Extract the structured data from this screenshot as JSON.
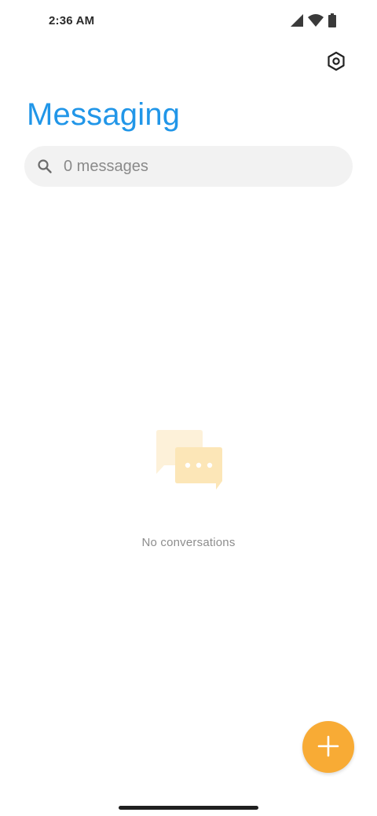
{
  "status_bar": {
    "time": "2:36 AM",
    "icons": [
      "signal-icon",
      "wifi-icon",
      "battery-icon"
    ]
  },
  "header": {
    "title": "Messaging",
    "settings_icon": "gear-icon"
  },
  "search": {
    "placeholder": "0 messages",
    "value": ""
  },
  "empty_state": {
    "icon": "conversations-icon",
    "text": "No conversations"
  },
  "fab": {
    "icon": "plus-icon",
    "color": "#f8ab35"
  },
  "colors": {
    "accent": "#2196e8",
    "fab": "#f8ab35",
    "search_bg": "#f2f2f2",
    "empty_text": "#8d8d8d"
  }
}
